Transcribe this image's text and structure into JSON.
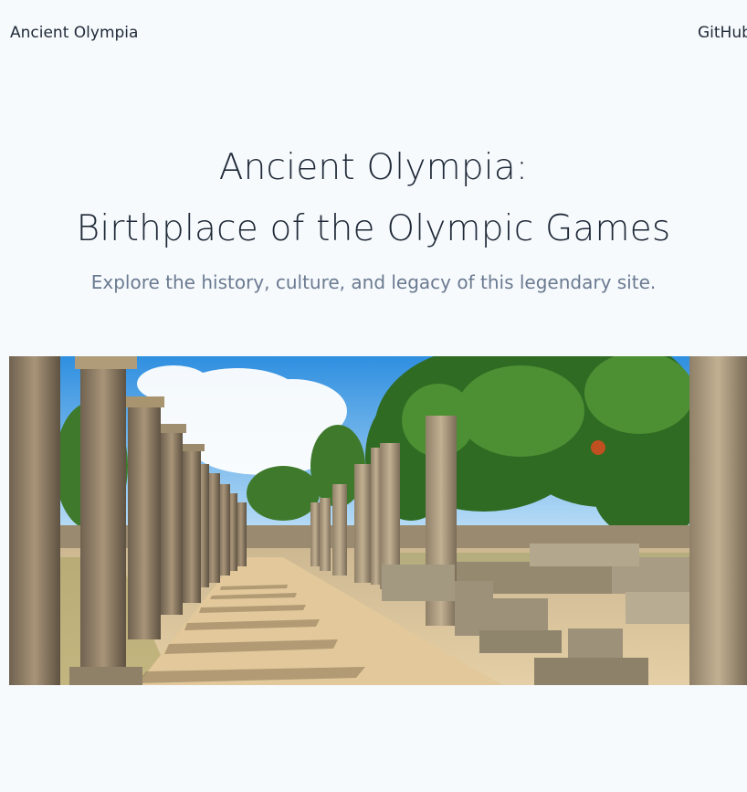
{
  "header": {
    "brand": "Ancient Olympia",
    "nav_github": "GitHub"
  },
  "hero": {
    "title_line1": "Ancient Olympia:",
    "title_line2": "Birthplace of the Olympic Games",
    "subtitle": "Explore the history, culture, and legacy of this legendary site."
  },
  "image": {
    "alt": "Ancient Olympia colonnade ruins"
  },
  "colors": {
    "background": "#f6fafd",
    "text": "#1f2937",
    "muted": "#6b7a90"
  }
}
